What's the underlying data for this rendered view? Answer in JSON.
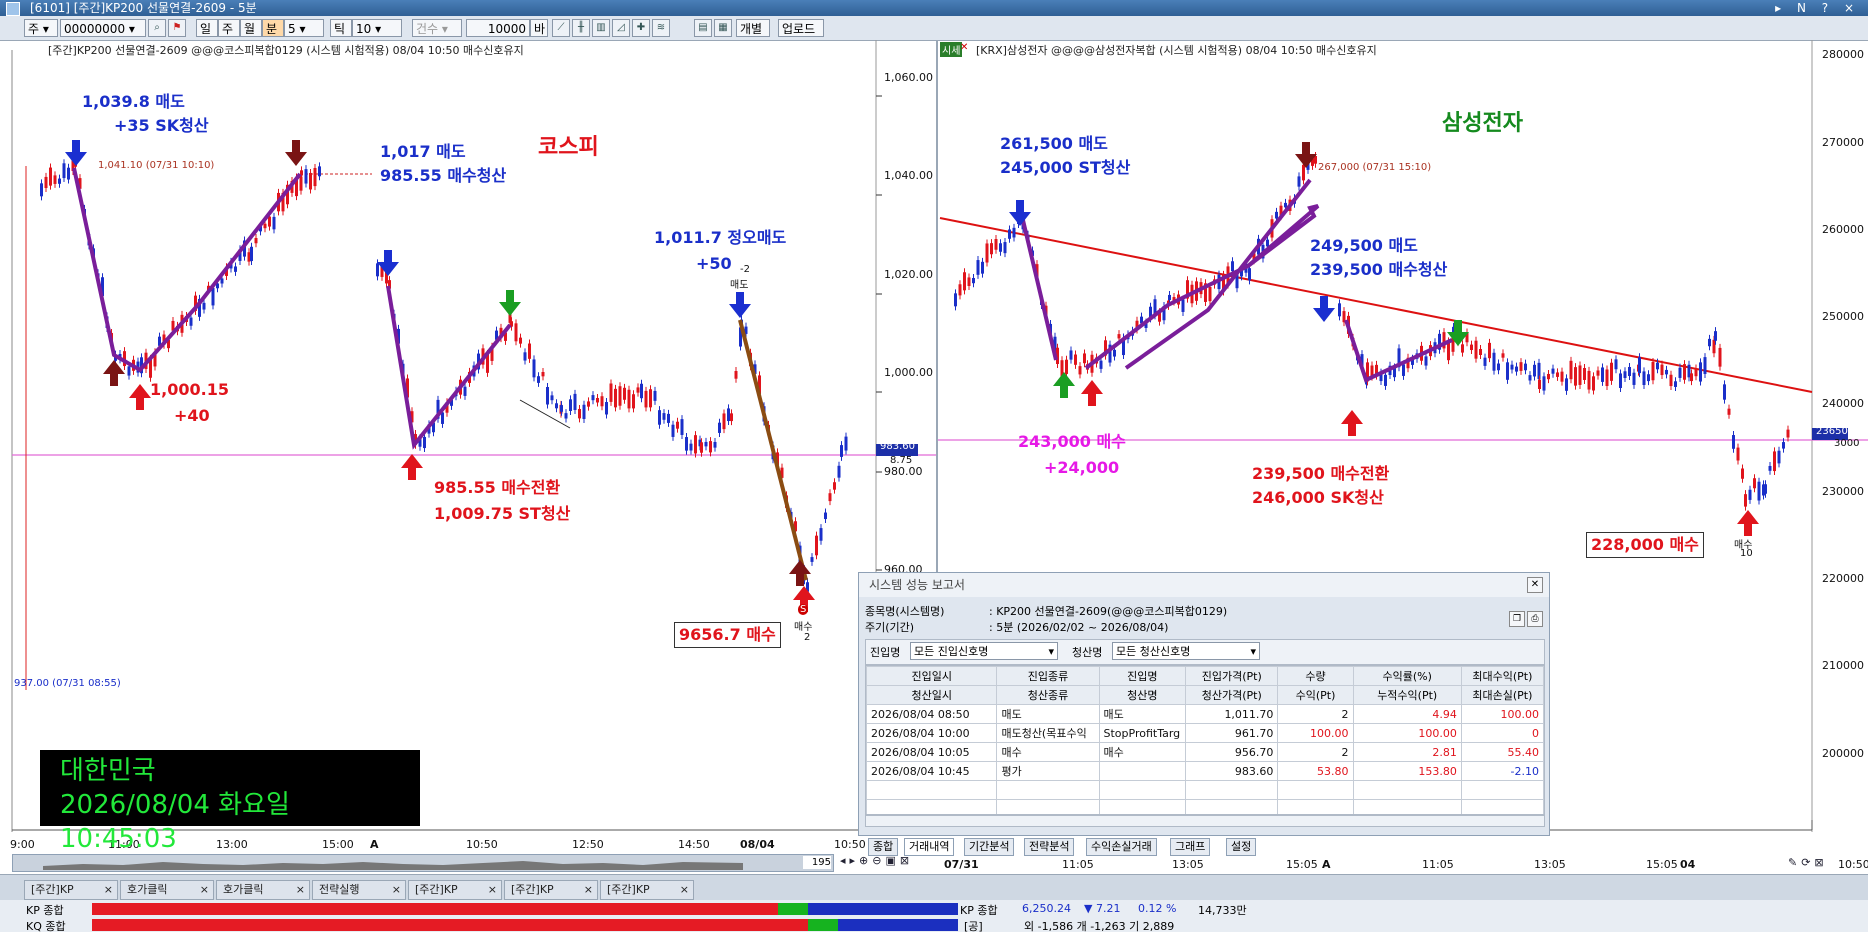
{
  "window": {
    "title": "[6101] [주간]KP200 선물연결-2609 - 5분",
    "controls": "▸ N ? ×"
  },
  "toolbar": {
    "mode": "주",
    "code": "00000000",
    "period_buttons": [
      "일",
      "주",
      "월",
      "분"
    ],
    "interval": "5",
    "tick_label": "틱",
    "tick_value": "10",
    "count_label": "건수",
    "count_value": "10000",
    "bi": "바",
    "individual": "개별",
    "upload": "업로드"
  },
  "left_chart": {
    "header": "[주간]KP200 선물연결-2609 @@@코스피복합0129 (시스템 시험적용) 08/04 10:50 매수신호유지",
    "y_ticks": [
      "1,060.00",
      "1,040.00",
      "1,020.00",
      "1,000.00",
      "980.00",
      "960.00"
    ],
    "x_ticks": [
      "9:00",
      "11:00",
      "13:00",
      "15:00",
      "A",
      "10:50",
      "12:50",
      "14:50",
      "08/04",
      "10:50"
    ],
    "price_tag": "983.60",
    "price_tag2": "8.75",
    "high_label": "1,041.10 (07/31 10:10)",
    "low_label": "937.00 (07/31 08:55)",
    "name": "코스피",
    "annotations": {
      "a1": "1,039.8 매도",
      "a1b": "+35 SK청산",
      "a2": "1,017 매도",
      "a2b": "985.55 매수청산",
      "a3": "1,000.15",
      "a3b": "+40",
      "a4": "985.55 매수전환",
      "a4b": "1,009.75 ST청산",
      "a5": "1,011.7 정오매도",
      "a5b": "+50",
      "a6": "9656.7 매수"
    },
    "small": {
      "s1": "-2",
      "s2": "매도",
      "s3": "S",
      "s4": "매수",
      "s5": "2"
    }
  },
  "right_chart": {
    "header_badge": "시세",
    "header": "[KRX]삼성전자 @@@@삼성전자복합 (시스템 시험적용) 08/04 10:50 매수신호유지",
    "y_ticks": [
      "280000",
      "270000",
      "260000",
      "250000",
      "240000",
      "230000",
      "220000",
      "210000",
      "200000"
    ],
    "x_ticks": [
      "07/31",
      "11:05",
      "13:05",
      "15:05",
      "A",
      "11:05",
      "13:05",
      "15:05",
      "04",
      "10:50"
    ],
    "price_tag": "236500",
    "price_tag2": "3000",
    "high_label": "267,000 (07/31 15:10)",
    "name": "삼성전자",
    "annotations": {
      "b1": "261,500 매도",
      "b1b": "245,000 ST청산",
      "b2": "249,500 매도",
      "b2b": "239,500 매수청산",
      "b3": "243,000 매수",
      "b3b": "+24,000",
      "b4": "239,500 매수전환",
      "b4b": "246,000 SK청산",
      "b5": "228,000 매수"
    },
    "small": {
      "s1": "매수",
      "s2": "10"
    }
  },
  "clock": {
    "line1": "대한민국",
    "line2": "2026/08/04 화요일  10:45:03"
  },
  "report": {
    "title": "시스템 성능 보고서",
    "system_label": "종목명(시스템명)",
    "system_value": ": KP200 선물연결-2609(@@@코스피복합0129)",
    "period_label": "주기(기간)",
    "period_value": ": 5분 (2026/02/02 ~ 2026/08/04)",
    "entry_label": "진입명",
    "entry_select": "모든 진입신호명",
    "exit_label": "청산명",
    "exit_select": "모든 청산신호명",
    "headers1": [
      "진입일시",
      "진입종류",
      "진입명",
      "진입가격(Pt)",
      "수량",
      "수익률(%)",
      "최대수익(Pt)"
    ],
    "headers2": [
      "청산일시",
      "청산종류",
      "청산명",
      "청산가격(Pt)",
      "수익(Pt)",
      "누적수익(Pt)",
      "최대손실(Pt)"
    ],
    "rows": [
      [
        "2026/08/04 08:50",
        "매도",
        "매도",
        "1,011.70",
        "2",
        "4.94",
        "100.00"
      ],
      [
        "2026/08/04 10:00",
        "매도청산(목표수익",
        "StopProfitTarg",
        "961.70",
        "100.00",
        "100.00",
        "0"
      ],
      [
        "2026/08/04 10:05",
        "매수",
        "매수",
        "956.70",
        "2",
        "2.81",
        "55.40"
      ],
      [
        "2026/08/04 10:45",
        "평가",
        "",
        "983.60",
        "53.80",
        "153.80",
        "-2.10"
      ]
    ],
    "tabs": [
      "종합",
      "거래내역",
      "기간분석",
      "전략분석",
      "수익손실거래",
      "그래프",
      "설정"
    ]
  },
  "scroll": {
    "left_value": "195"
  },
  "window_tabs": [
    "[주간]KP",
    "호가클릭",
    "호가클릭",
    "전략실행",
    "[주간]KP",
    "[주간]KP",
    "[주간]KP"
  ],
  "bottom_rows": {
    "row1_label": "KP 종합",
    "row2_label": "KQ 종합",
    "index_name": "KP 종합",
    "index_value": "6,250.24",
    "index_change": "▼ 7.21",
    "index_pct": "0.12 %",
    "index_volume": "14,733만",
    "row2_name": "[공]",
    "row2_info": "외 -1,586   개 -1,263   기 2,889"
  }
}
